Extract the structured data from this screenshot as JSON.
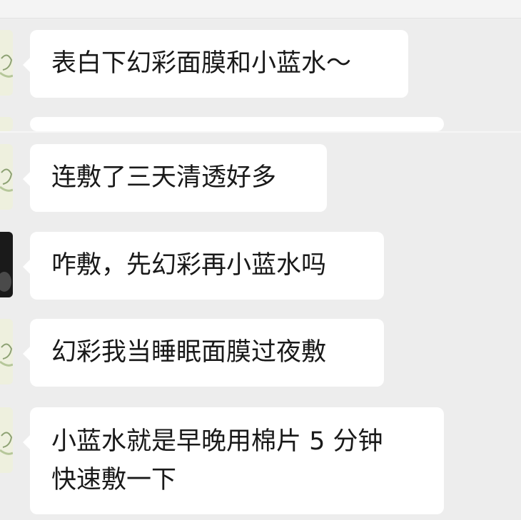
{
  "chat": {
    "messages": [
      {
        "text": "表白下幻彩面膜和小蓝水～"
      },
      {
        "text": ""
      },
      {
        "text": "连敷了三天清透好多"
      },
      {
        "text": "咋敷，先幻彩再小蓝水吗"
      },
      {
        "text": "幻彩我当睡眠面膜过夜敷"
      },
      {
        "lines": [
          "小蓝水就是早晚用棉片 5 分钟",
          "快速敷一下"
        ]
      }
    ]
  },
  "colors": {
    "background": "#ededed",
    "bubble": "#ffffff",
    "text": "#191919",
    "avatar_green": "#eef0de",
    "avatar_dark": "#1a1a1a"
  }
}
